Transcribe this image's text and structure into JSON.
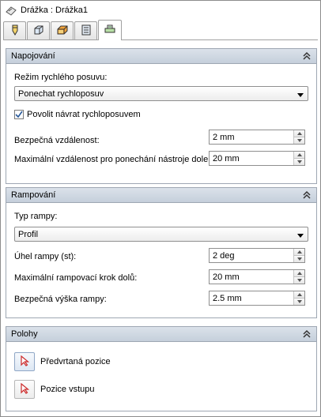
{
  "window": {
    "title": "Drážka : Drážka1"
  },
  "tabs": [
    {
      "name": "tool"
    },
    {
      "name": "shape"
    },
    {
      "name": "heights"
    },
    {
      "name": "passes"
    },
    {
      "name": "linking",
      "active": true
    }
  ],
  "linking": {
    "title": "Napojování",
    "retract_label": "Režim rychlého posuvu:",
    "retract_value": "Ponechat rychloposuv",
    "allow_rapid_label": "Povolit návrat rychloposuvem",
    "allow_rapid_checked": true,
    "safe_distance_label": "Bezpečná vzdálenost:",
    "safe_distance_value": "2 mm",
    "max_stay_down_label": "Maximální vzdálenost pro ponechání nástroje dole:",
    "max_stay_down_value": "20 mm"
  },
  "ramping": {
    "title": "Rampování",
    "ramp_type_label": "Typ rampy:",
    "ramp_type_value": "Profil",
    "ramp_angle_label": "Úhel rampy (st):",
    "ramp_angle_value": "2 deg",
    "max_stepdown_label": "Maximální rampovací krok dolů:",
    "max_stepdown_value": "20 mm",
    "ramp_height_label": "Bezpečná výška rampy:",
    "ramp_height_value": "2.5 mm"
  },
  "positions": {
    "title": "Polohy",
    "predrill_label": "Předvrtaná pozice",
    "entry_label": "Pozice vstupu"
  },
  "colors": {
    "section_header": "#c9d3df",
    "accent_arrow": "#cc2a2a"
  }
}
